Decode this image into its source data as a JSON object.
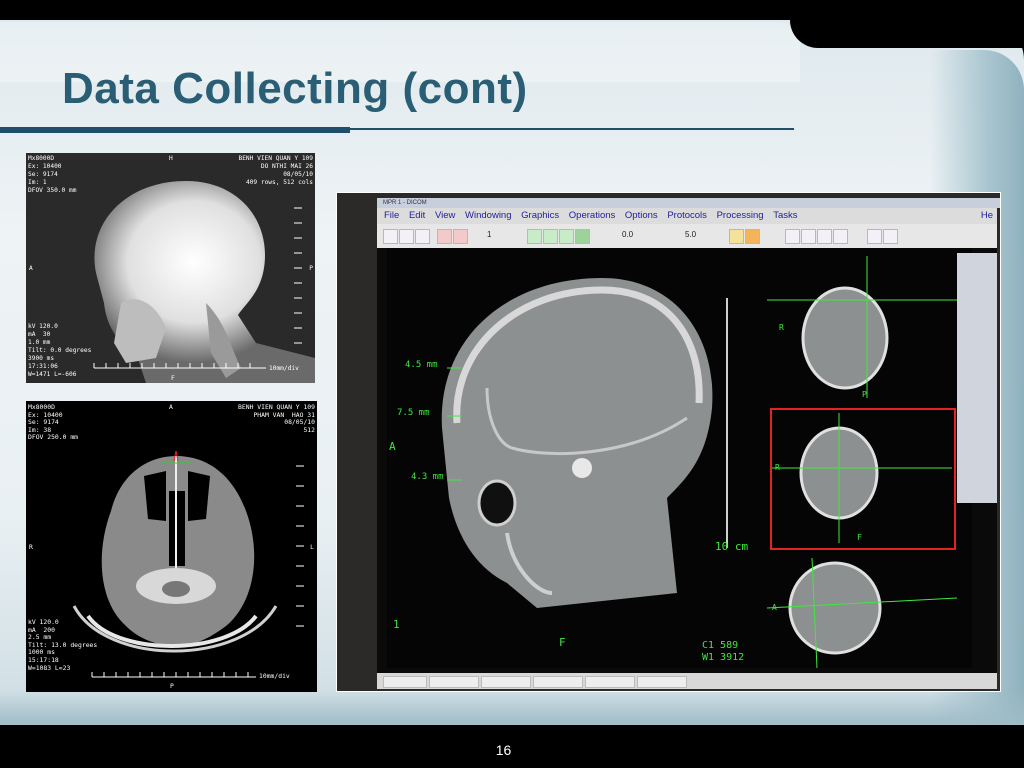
{
  "slide": {
    "title": "Data Collecting (cont)",
    "page_number": "16"
  },
  "ct_lateral": {
    "top_left": "Mx8000D\nEx: 10400\nSe: 9174\nIm: 1\nDFOV 350.0 mm",
    "top_center": "H",
    "top_right": "BENH VIEN QUAN Y 109\nDO NTHI MAI 26\n08/05/10\n409 rows, 512 cols",
    "left_mid": "A",
    "right_mid": "P",
    "bottom_left": "kV 120.0\nmA  30\n1.0 mm\nTilt: 0.0 degrees\n3900 ms\n17:31:06\nW=1471 L=-606",
    "bottom_center": "F",
    "scale_label": "10mm/div"
  },
  "ct_axial": {
    "top_left": "Mx8000D\nEx: 10400\nSe: 9174\nIm: 38\nDFOV 250.0 mm",
    "top_center": "A",
    "top_right": "BENH VIEN QUAN Y 109\nPHAM VAN  HAO 31\n08/05/10\n512",
    "left_mid": "R",
    "right_mid": "L",
    "bottom_left": "kV 120.0\nmA  200\n2.5 mm\nTilt: 13.0 degrees\n1000 ms\n15:17:18\nW=1083 L=23",
    "bottom_center": "P",
    "scale_label": "10mm/div"
  },
  "monitor": {
    "menu": [
      "File",
      "Edit",
      "View",
      "Windowing",
      "Graphics",
      "Operations",
      "Options",
      "Protocols",
      "Processing",
      "Tasks"
    ],
    "menu_right": "He",
    "toolbar_values": [
      "1",
      "0.0",
      "5.0"
    ],
    "measurements": [
      "4.5 mm",
      "7.5 mm",
      "4.3 mm"
    ],
    "orientation_a": "A",
    "orientation_f": "F",
    "scale": "10 cm",
    "corner_num": "1",
    "window_c": "C1   589",
    "window_w": "W1  3912",
    "mpr_labels": {
      "r1": "R",
      "r2": "R",
      "a": "A",
      "f": "F",
      "p": "P"
    }
  },
  "colors": {
    "title": "#2a5e75",
    "rule": "#1f4f6a",
    "overlay_green": "#3fe83f",
    "selected_border": "#e32222"
  }
}
